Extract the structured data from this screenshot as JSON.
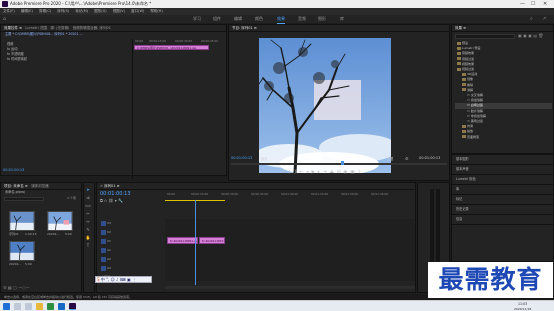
{
  "window": {
    "title": "Adobe Premiere Pro 2020 - C:\\用户\\...\\Adobe\\Premiere Pro\\14.0\\未命名 *",
    "minimize": "—",
    "maximize": "☐",
    "close": "✕"
  },
  "menu": [
    "文件(F)",
    "编辑(E)",
    "剪辑(C)",
    "序列(S)",
    "标记(M)",
    "图形(G)",
    "视图(V)",
    "窗口(W)",
    "帮助(H)"
  ],
  "workspace_tabs": [
    {
      "label": "学习"
    },
    {
      "label": "组件"
    },
    {
      "label": "编辑"
    },
    {
      "label": "颜色"
    },
    {
      "label": "效果",
      "active": true
    },
    {
      "label": "音频"
    },
    {
      "label": "图形"
    },
    {
      "label": "库"
    }
  ],
  "source_panel": {
    "tabs": [
      "效果控件 ≡",
      "Lumetri 范围",
      "源: (无剪辑)",
      "音频剪辑混合器: 序列01"
    ],
    "breadcrumb": "主要 * C:\\DMRS\\图片\\PSBHU8...  序列01 * 20201 ...",
    "rows": [
      "视频",
      "fx 运动",
      "fx 不透明度",
      "fx 时间重映射"
    ],
    "ruler": [
      "00:00",
      "00:00:15:00",
      "00:00:30:00",
      "00:00:45:00"
    ],
    "clip_label": "C:\\DMRS\\图片\\PSBHU8...\\20201118091.jpg",
    "timecode": "00:01:00:13"
  },
  "program_panel": {
    "tab": "节目: 序列01 ≡",
    "timecode": "00:01:00:13",
    "fit": "适合",
    "quality": "完整",
    "duration": "00:01:00:13"
  },
  "project_panel": {
    "tabs": [
      "项目: 未命名 ≡",
      "媒体浏览器"
    ],
    "file": "未命名.prproj",
    "search_placeholder": "",
    "items_count": "3 个项",
    "items": [
      {
        "name": "序列01",
        "duration": "1:00:13"
      },
      {
        "name": "20201...",
        "duration": "5:00"
      },
      {
        "name": "20201...",
        "duration": "5:00"
      }
    ]
  },
  "timeline": {
    "tab": "序列01 ≡",
    "timecode": "00:01:00:13",
    "ruler": [
      "00:00",
      "00:00:15:00",
      "00:00:30:00",
      "00:00:45:00",
      "00:01:00:00",
      "00:01:15:00",
      "00:01:30:00",
      "00:01:45:00"
    ],
    "tracks": [
      "V3",
      "V2",
      "V1",
      "A1",
      "A2",
      "A3",
      "主声道"
    ],
    "master_value": "0.0",
    "clips": [
      {
        "label": "fx 20201118091.jpg"
      },
      {
        "label": "fx 20201118151.jpg"
      }
    ]
  },
  "effects_panel": {
    "tab": "效果 ≡",
    "tree": [
      {
        "label": "预设",
        "level": 0
      },
      {
        "label": "Lumetri 预设",
        "level": 0
      },
      {
        "label": "音频效果",
        "level": 0
      },
      {
        "label": "音频过渡",
        "level": 0
      },
      {
        "label": "视频效果",
        "level": 0
      },
      {
        "label": "视频过渡",
        "level": 0
      },
      {
        "label": "3D运动",
        "level": 1
      },
      {
        "label": "划像",
        "level": 1
      },
      {
        "label": "擦除",
        "level": 1
      },
      {
        "label": "溶解",
        "level": 1
      },
      {
        "label": "交叉溶解",
        "level": 2
      },
      {
        "label": "叠加溶解",
        "level": 2
      },
      {
        "label": "白场过渡",
        "level": 2,
        "selected": true
      },
      {
        "label": "胶片溶解",
        "level": 2
      },
      {
        "label": "非叠加溶解",
        "level": 2
      },
      {
        "label": "黑场过渡",
        "level": 2
      },
      {
        "label": "内滑",
        "level": 1
      },
      {
        "label": "缩放",
        "level": 1
      },
      {
        "label": "页面剥落",
        "level": 1
      }
    ],
    "side_sections": [
      "基本图形",
      "基本声音",
      "Lumetri 颜色",
      "库",
      "标记",
      "历史记录",
      "信息"
    ]
  },
  "status_bar": {
    "text": "单击以选择，或者在空白区域单击并拖动以进行框选。使用 Shift、Alt 和 Ctrl 可获得其他选项。"
  },
  "taskbar": {
    "time": "11:03",
    "date": "2020/11/18"
  },
  "watermark": {
    "text": "最需教育"
  },
  "colors": {
    "accent": "#4aa3ff",
    "clip": "#d77fd9",
    "playhead": "#4a8fe0"
  }
}
